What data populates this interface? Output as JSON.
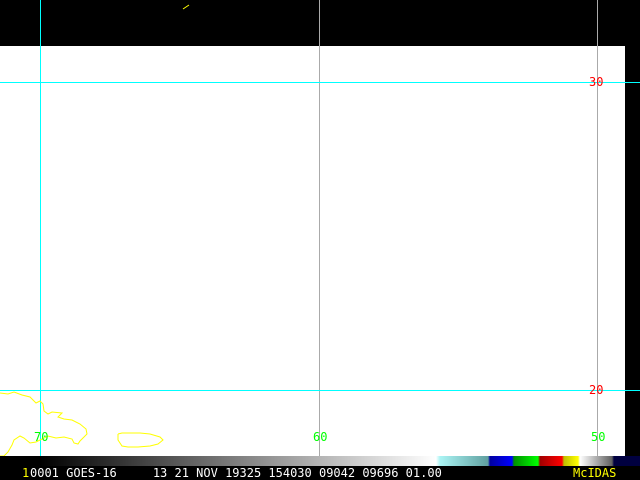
{
  "grid": {
    "lat_labels": [
      "30",
      "20"
    ],
    "lon_labels": [
      "70",
      "60",
      "50"
    ]
  },
  "status_bar": {
    "frame": "1",
    "text": "0001 GOES-16     13 21 NOV 19325 154030 09042 09696 01.00",
    "brand": "McIDAS"
  },
  "colors": {
    "grid_primary": "#00ffff",
    "grid_secondary": "#aaaaaa",
    "coastline": "#ffff00",
    "lat_label": "#ff0000",
    "lon_label": "#00ff00"
  }
}
